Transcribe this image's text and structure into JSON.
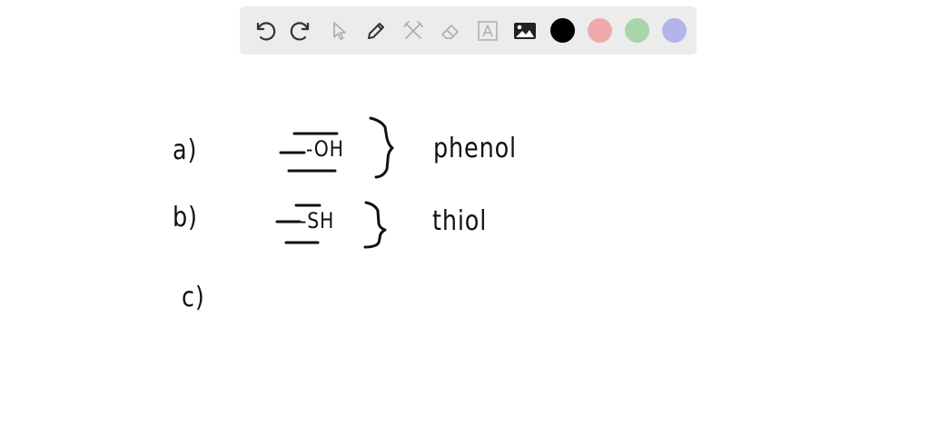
{
  "toolbar": {
    "tools": [
      {
        "name": "undo-icon",
        "enabled": true
      },
      {
        "name": "redo-icon",
        "enabled": true
      },
      {
        "name": "pointer-icon",
        "enabled": false
      },
      {
        "name": "pencil-icon",
        "enabled": true
      },
      {
        "name": "tools-icon",
        "enabled": false
      },
      {
        "name": "eraser-icon",
        "enabled": false
      },
      {
        "name": "text-icon",
        "enabled": false
      },
      {
        "name": "image-icon",
        "enabled": true
      }
    ],
    "colors": [
      "#000000",
      "#eeaaaa",
      "#aad4aa",
      "#b4b4ec"
    ],
    "selected_color": "#000000"
  },
  "whiteboard": {
    "items": [
      {
        "label": "a)",
        "group": "-OH",
        "name": "phenol"
      },
      {
        "label": "b)",
        "group": "-SH",
        "name": "thiol"
      },
      {
        "label": "c)",
        "group": "",
        "name": ""
      }
    ]
  }
}
